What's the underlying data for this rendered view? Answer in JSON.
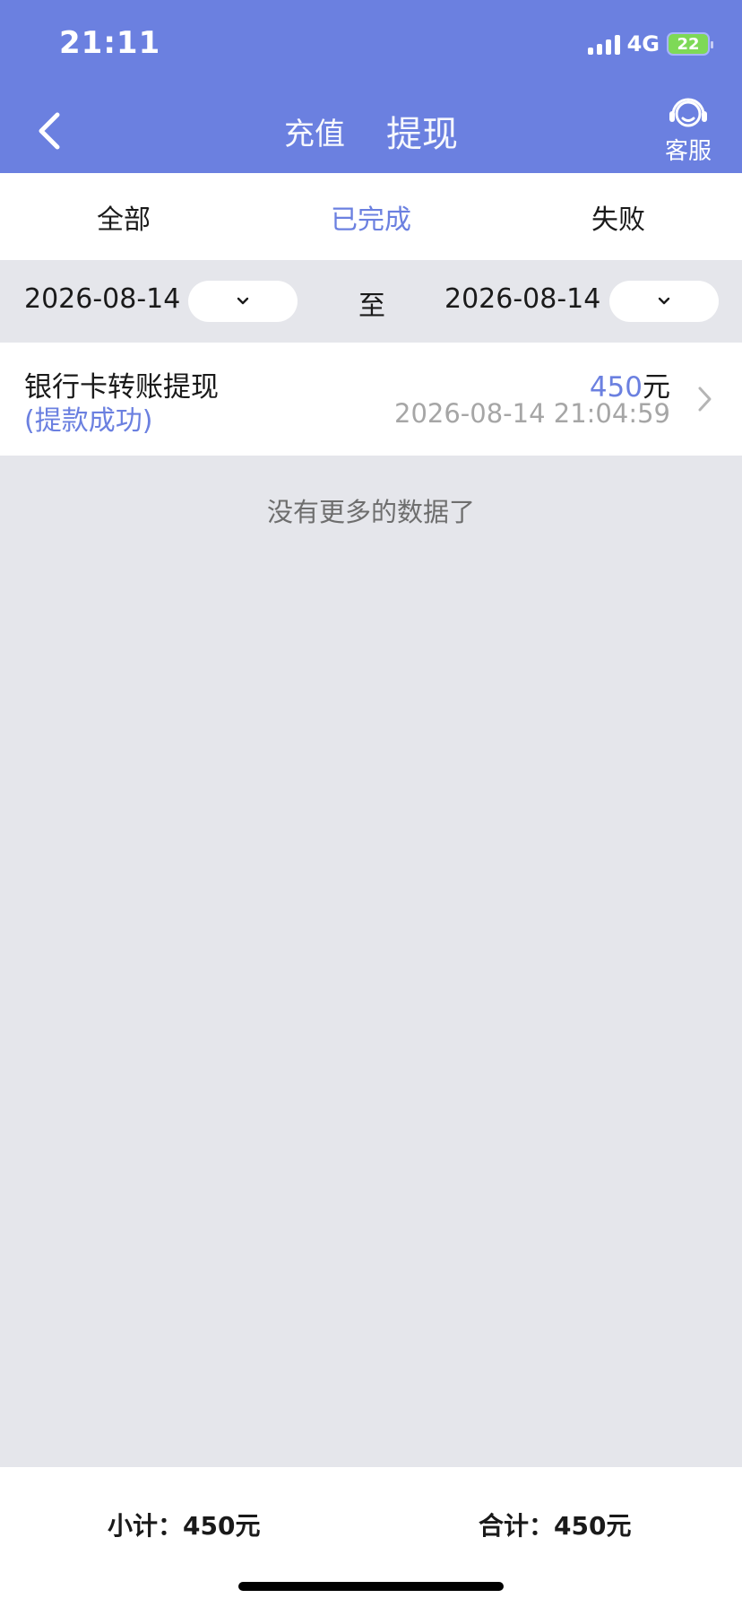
{
  "status_bar": {
    "time": "21:11",
    "network": "4G",
    "battery": "22"
  },
  "header": {
    "tabs": [
      {
        "label": "充值",
        "active": false
      },
      {
        "label": "提现",
        "active": true
      }
    ],
    "service_label": "客服"
  },
  "filter_tabs": [
    {
      "label": "全部",
      "active": false
    },
    {
      "label": "已完成",
      "active": true
    },
    {
      "label": "失败",
      "active": false
    }
  ],
  "date_range": {
    "start": "2026-08-14",
    "separator": "至",
    "end": "2026-08-14"
  },
  "records": [
    {
      "title": "银行卡转账提现",
      "status": "(提款成功)",
      "amount": "450",
      "unit": "元",
      "time": "2026-08-14 21:04:59"
    }
  ],
  "no_more_text": "没有更多的数据了",
  "footer": {
    "subtotal_label": "小计：",
    "subtotal_value": "450",
    "total_label": "合计：",
    "total_value": "450",
    "unit": "元"
  },
  "colors": {
    "accent": "#6b80e0",
    "background": "#e5e6eb",
    "battery": "#7ed957"
  }
}
